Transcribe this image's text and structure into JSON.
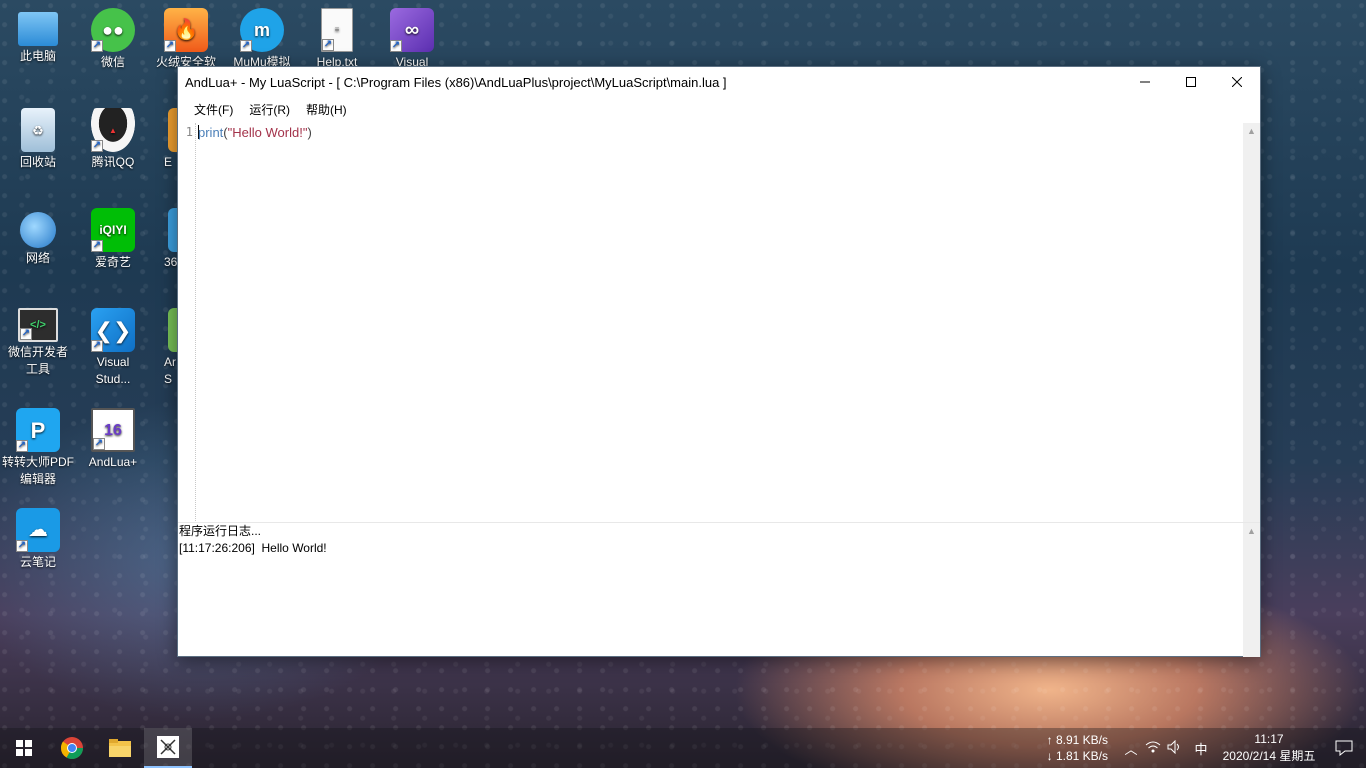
{
  "desktop": {
    "icons": [
      {
        "label": "此电脑"
      },
      {
        "label": "微信"
      },
      {
        "label": "火绒安全软"
      },
      {
        "label": "MuMu模拟"
      },
      {
        "label": "Help.txt"
      },
      {
        "label": "Visual"
      },
      {
        "label": "回收站"
      },
      {
        "label": "腾讯QQ"
      },
      {
        "label": "E"
      },
      {
        "label": "网络"
      },
      {
        "label": "爱奇艺"
      },
      {
        "label": "36"
      },
      {
        "label": "微信开发者\n工具"
      },
      {
        "label": "Visual\nStud..."
      },
      {
        "label": "Ar\nS"
      },
      {
        "label": "转转大师PDF\n编辑器"
      },
      {
        "label": "AndLua+"
      },
      {
        "label": "云笔记"
      }
    ]
  },
  "window": {
    "title": "AndLua+ - My LuaScript - [ C:\\Program Files (x86)\\AndLuaPlus\\project\\MyLuaScript\\main.lua ]",
    "menu": [
      "文件(F)",
      "运行(R)",
      "帮助(H)"
    ],
    "editor": {
      "line_number": "1",
      "code_fn": "print",
      "code_open": "(",
      "code_str": "\"Hello World!\"",
      "code_close": ")"
    },
    "log": {
      "header": "程序运行日志...",
      "entry": "[11:17:26:206]  Hello World!"
    }
  },
  "taskbar": {
    "net_up": "↑ 8.91 KB/s",
    "net_down": "↓ 1.81 KB/s",
    "ime": "中",
    "time": "11:17",
    "date": "2020/2/14 星期五"
  },
  "colors": {
    "code_fn": "#4a7fb8",
    "code_str": "#a3324a",
    "accent": "#8ec3ff"
  }
}
